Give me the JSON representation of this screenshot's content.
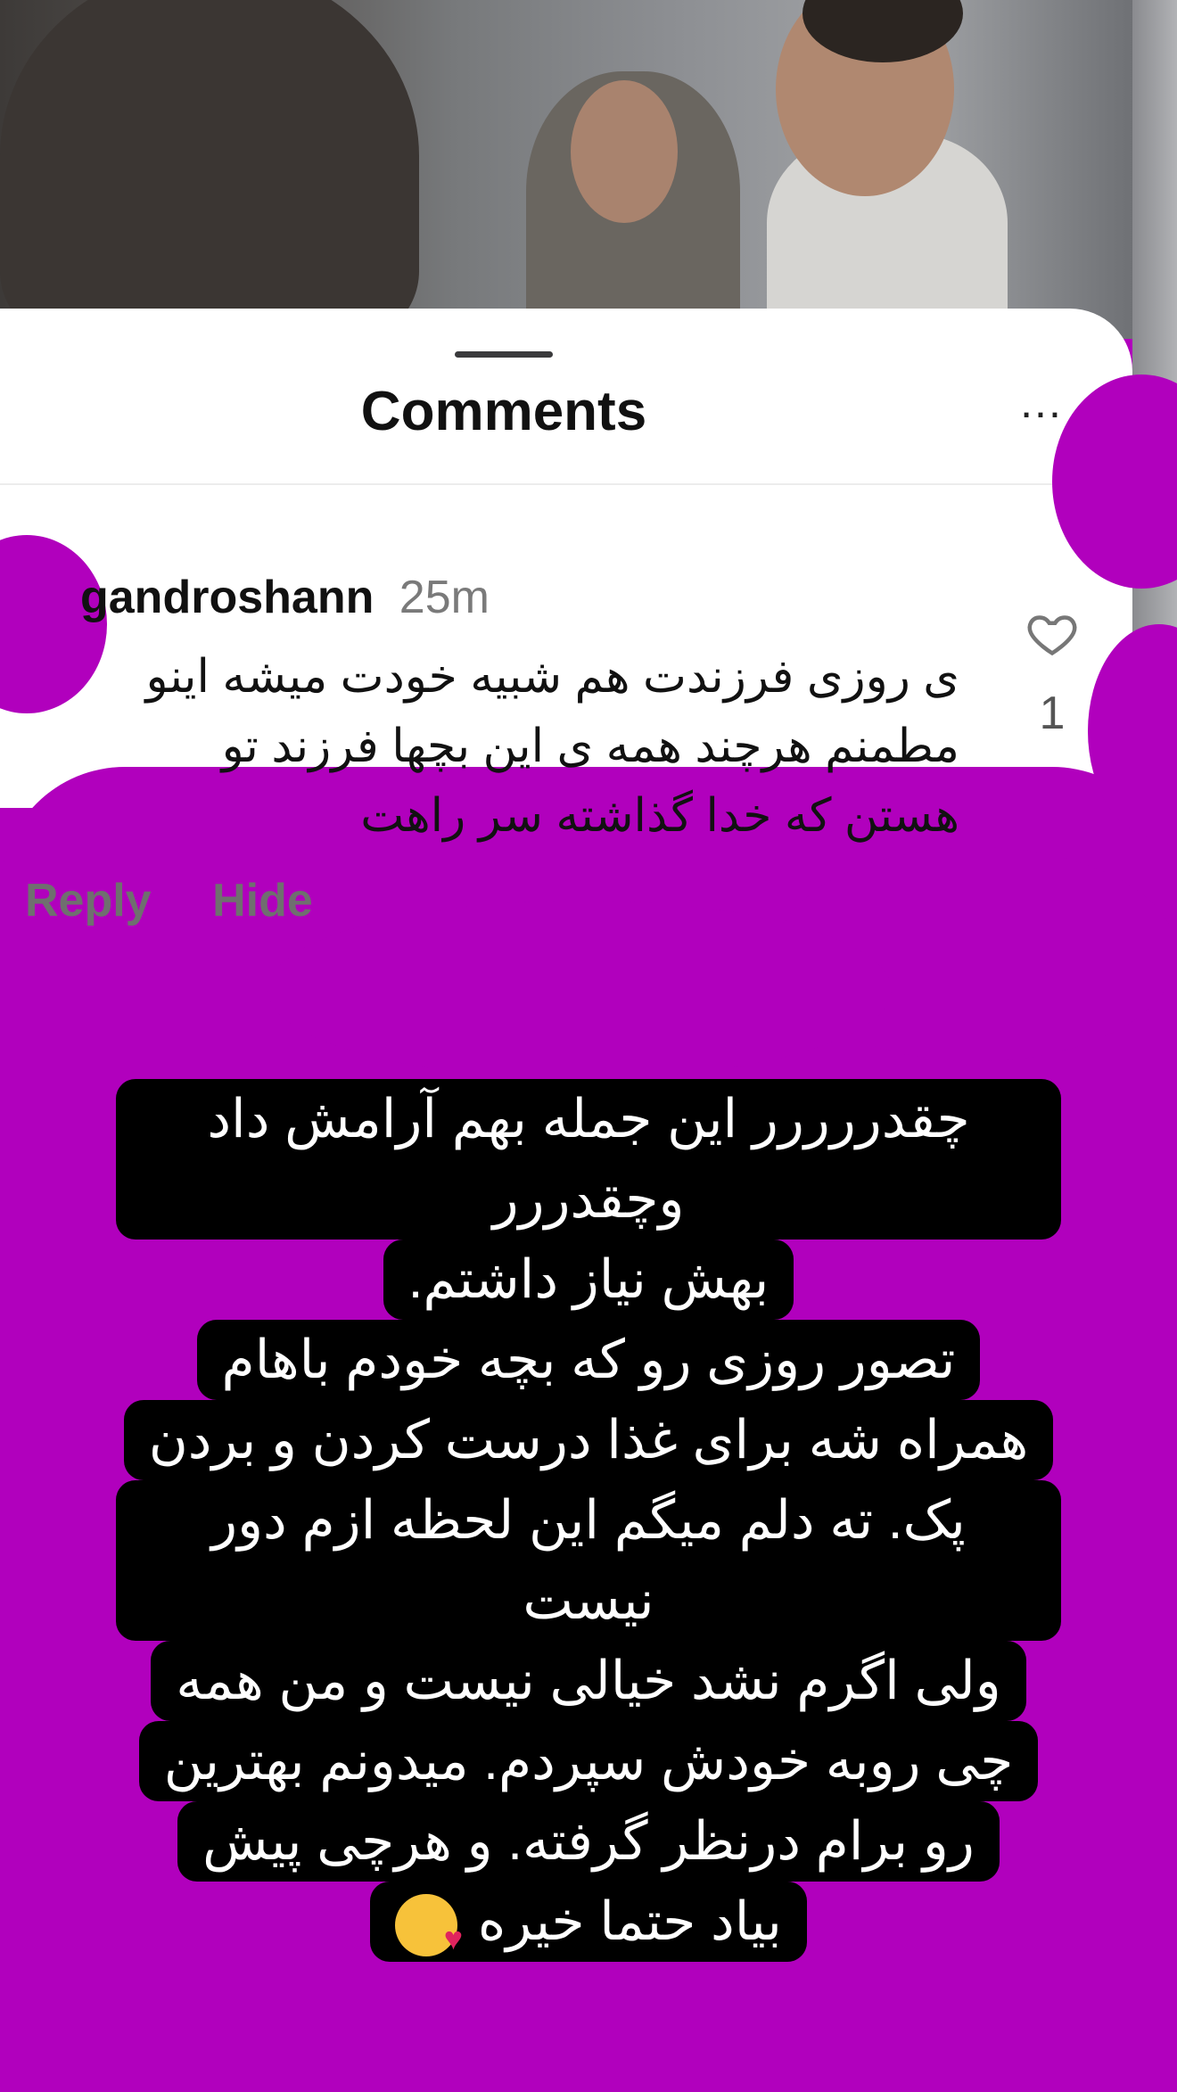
{
  "sheet": {
    "title": "Comments",
    "more_label": "..."
  },
  "comment": {
    "username": "gandroshann",
    "time": "25m",
    "lines": [
      "ی روزی فرزندت هم شبیه خودت میشه اینو",
      "مطمنم هرچند همه ی این بچها فرزند تو",
      "هستن که خدا گذاشته سر راهت"
    ],
    "reply_label": "Reply",
    "hide_label": "Hide",
    "likes": "1"
  },
  "caption": {
    "lines": [
      "چقدررررر این جمله بهم آرامش داد وچقدررر",
      "بهش نیاز داشتم.",
      "تصور روزی رو که بچه خودم باهام",
      "همراه شه برای غذا درست کردن و بردن",
      "پک. ته دلم میگم این لحظه ازم دور نیست",
      "ولی اگرم نشد خیالی نیست و من همه",
      "چی روبه خودش سپردم. میدونم بهترین",
      "رو برام درنظر گرفته. و هرچی پیش",
      "بیاد حتما خیره"
    ],
    "emoji": "kiss-emoji-icon"
  }
}
